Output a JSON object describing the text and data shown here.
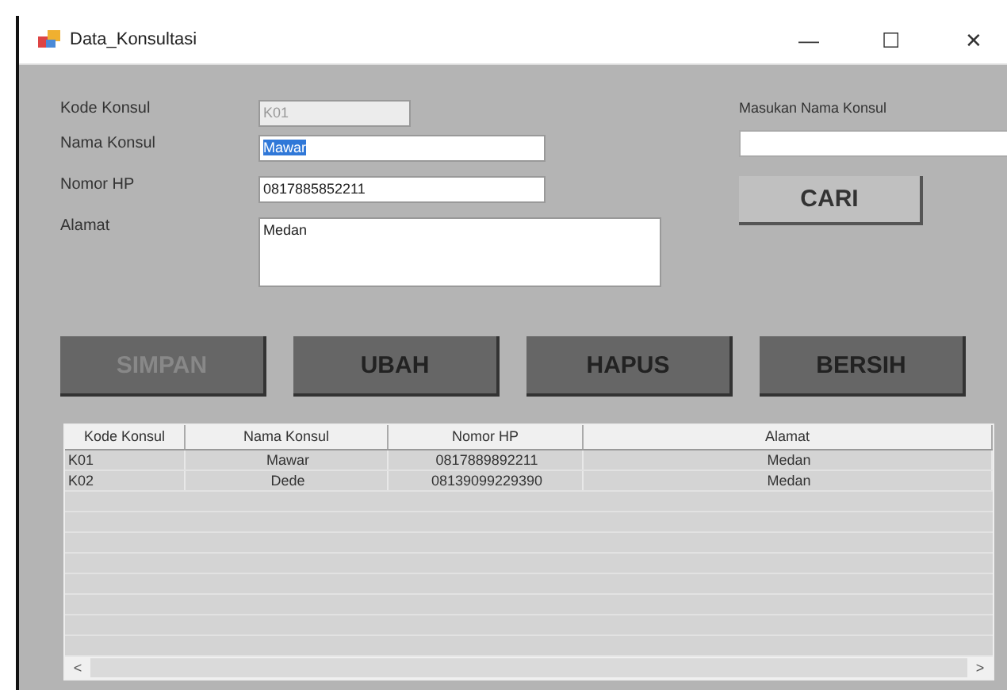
{
  "window": {
    "title": "Data_Konsultasi",
    "controls": [
      "—",
      "☐",
      "✕"
    ]
  },
  "form": [
    {
      "label": "Kode Konsul",
      "value": "K01",
      "kind": "line",
      "disabled": true,
      "selected": false
    },
    {
      "label": "Nama Konsul",
      "value": "Mawar",
      "kind": "line",
      "disabled": false,
      "selected": true
    },
    {
      "label": "Nomor HP",
      "value": "0817885852211",
      "kind": "line",
      "disabled": false,
      "selected": false
    },
    {
      "label": "Alamat",
      "value": "Medan",
      "kind": "area",
      "disabled": false,
      "selected": false
    }
  ],
  "search": {
    "label": "Masukan Nama Konsul",
    "button": "CARI"
  },
  "buttons": [
    {
      "label": "SIMPAN",
      "disabled": true
    },
    {
      "label": "UBAH",
      "disabled": false
    },
    {
      "label": "HAPUS",
      "disabled": false
    },
    {
      "label": "BERSIH",
      "disabled": false
    }
  ],
  "table": {
    "columns": [
      "Kode Konsul",
      "Nama Konsul",
      "Nomor HP",
      "Alamat"
    ],
    "rows": [
      [
        "K01",
        "Mawar",
        "0817889892211",
        "Medan"
      ],
      [
        "K02",
        "Dede",
        "08139099229390",
        "Medan"
      ]
    ],
    "scroll": {
      "left": "<",
      "right": ">"
    }
  }
}
